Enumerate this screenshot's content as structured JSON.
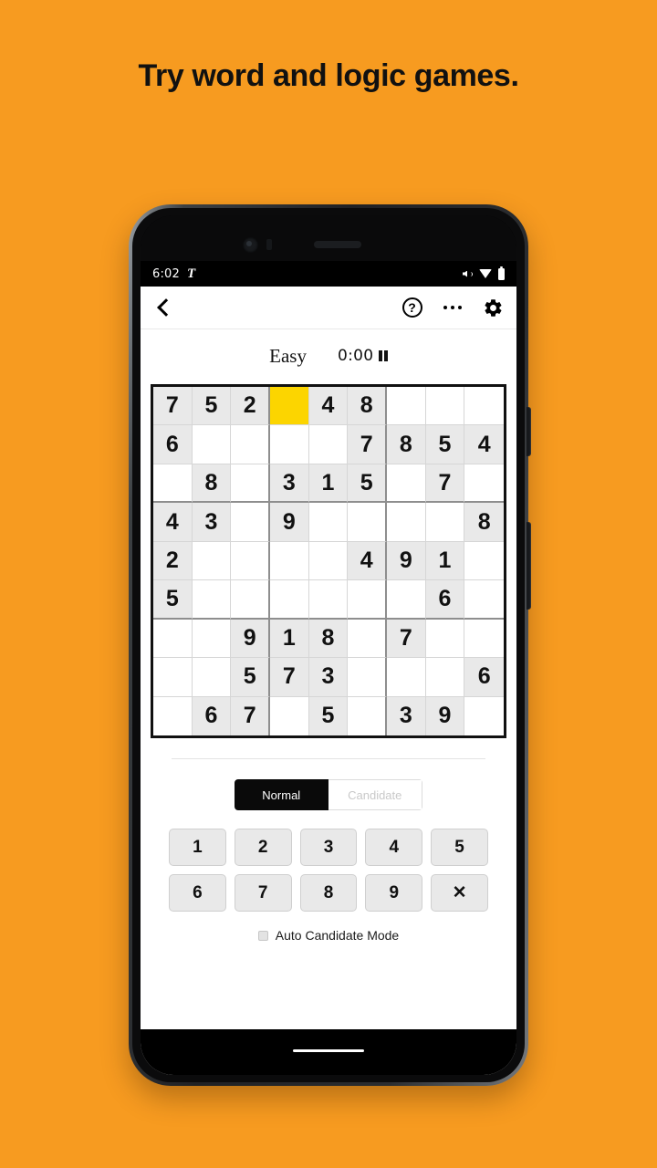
{
  "promo": {
    "headline": "Try word and logic games."
  },
  "phone": {
    "status_bar": {
      "time": "6:02",
      "app_mark": "T",
      "icons": [
        "vibrate-icon",
        "wifi-icon",
        "battery-icon"
      ]
    },
    "nav_bar": {
      "home_indicator": "home-indicator"
    }
  },
  "app": {
    "appbar": {
      "back_icon": "back-chevron-icon",
      "help_label": "?",
      "help_icon": "help-circle-icon",
      "more_icon": "more-options-icon",
      "settings_icon": "gear-icon"
    },
    "meta": {
      "difficulty": "Easy",
      "timer": "0:00",
      "pause_icon": "pause-icon"
    },
    "board": {
      "selected": {
        "row": 0,
        "col": 3
      },
      "selected_color": "#FCD500",
      "given_cell_color": "#E9E9E9",
      "empty_cell_color": "#FFFFFF",
      "rows": [
        [
          "7",
          "5",
          "2",
          "",
          "4",
          "8",
          "",
          "",
          ""
        ],
        [
          "6",
          "",
          "",
          "",
          "",
          "7",
          "8",
          "5",
          "4"
        ],
        [
          "",
          "8",
          "",
          "3",
          "1",
          "5",
          "",
          "7",
          ""
        ],
        [
          "4",
          "3",
          "",
          "9",
          "",
          "",
          "",
          "",
          "8"
        ],
        [
          "2",
          "",
          "",
          "",
          "",
          "4",
          "9",
          "1",
          ""
        ],
        [
          "5",
          "",
          "",
          "",
          "",
          "",
          "",
          "6",
          ""
        ],
        [
          "",
          "",
          "9",
          "1",
          "8",
          "",
          "7",
          "",
          ""
        ],
        [
          "",
          "",
          "5",
          "7",
          "3",
          "",
          "",
          "",
          "6"
        ],
        [
          "",
          "6",
          "7",
          "",
          "5",
          "",
          "3",
          "9",
          ""
        ]
      ]
    },
    "mode_toggle": {
      "normal_label": "Normal",
      "candidate_label": "Candidate",
      "active": "Normal"
    },
    "keypad": {
      "keys": [
        "1",
        "2",
        "3",
        "4",
        "5",
        "6",
        "7",
        "8",
        "9",
        "✕"
      ],
      "erase_icon": "erase-x-icon"
    },
    "auto_candidate": {
      "label": "Auto Candidate Mode",
      "checked": false
    }
  },
  "colors": {
    "background": "#F79B20",
    "accent_selected": "#FCD500",
    "toggle_active_bg": "#0A0A0A"
  }
}
